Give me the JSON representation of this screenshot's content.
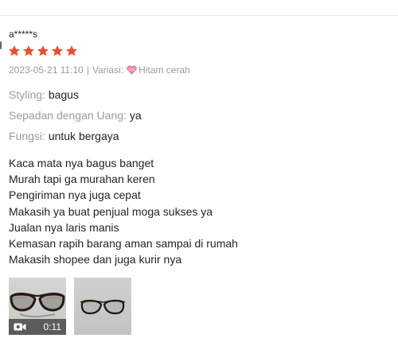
{
  "review": {
    "username": "a*****s",
    "rating": 5,
    "date": "2023-05-21 11:10",
    "separator": "|",
    "variation_label": "Variasi:",
    "variation_value": "Hitam cerah",
    "attributes": [
      {
        "label": "Styling:",
        "value": "bagus"
      },
      {
        "label": "Sepadan dengan Uang:",
        "value": "ya"
      },
      {
        "label": "Fungsi:",
        "value": "untuk bergaya"
      }
    ],
    "text_lines": [
      "Kaca mata nya bagus banget",
      "Murah tapi ga murahan keren",
      "Pengiriman nya juga cepat",
      "Makasih ya buat penjual moga sukses ya",
      "Jualan nya laris manis",
      "Kemasan rapih barang aman sampai di rumah",
      "Makasih shopee dan juga kurir nya"
    ],
    "media": {
      "video_duration": "0:11",
      "video_icon": "video-camera-icon",
      "image_icon": "glasses-photo"
    }
  },
  "colors": {
    "star": "#ee4d2d",
    "muted_text": "#9b9b9b",
    "heart": "#f58b9c"
  }
}
